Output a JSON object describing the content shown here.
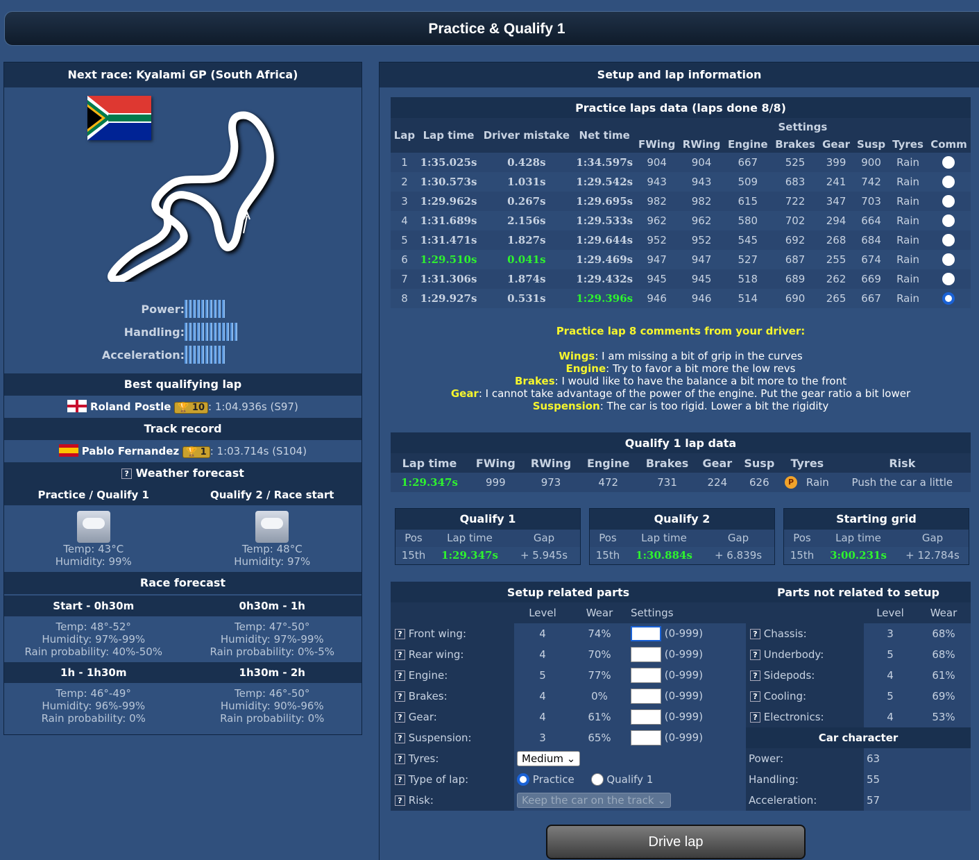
{
  "page_title": "Practice & Qualify 1",
  "left": {
    "next_race": "Next race: Kyalami GP (South Africa)",
    "stats": {
      "power_label": "Power:",
      "power_bars": 10,
      "handling_label": "Handling:",
      "handling_bars": 13,
      "accel_label": "Acceleration:",
      "accel_bars": 10
    },
    "best_q_title": "Best qualifying lap",
    "best_q": {
      "name": "Roland Postle",
      "trophy": "10",
      "time": ":  1:04.936s  (S97)"
    },
    "track_record_title": "Track record",
    "track_record": {
      "name": "Pablo Fernandez",
      "trophy": "1",
      "time": ":  1:03.714s  (S104)"
    },
    "weather_title": "Weather forecast",
    "w1": {
      "head": "Practice / Qualify 1",
      "temp": "Temp: 43°C",
      "hum": "Humidity: 99%"
    },
    "w2": {
      "head": "Qualify 2 / Race start",
      "temp": "Temp: 48°C",
      "hum": "Humidity: 97%"
    },
    "race_forecast_title": "Race forecast",
    "rf": [
      {
        "head": "Start - 0h30m",
        "temp": "Temp: 48°-52°",
        "hum": "Humidity: 97%-99%",
        "rain": "Rain probability: 40%-50%"
      },
      {
        "head": "0h30m - 1h",
        "temp": "Temp: 47°-50°",
        "hum": "Humidity: 97%-99%",
        "rain": "Rain probability: 0%-5%"
      },
      {
        "head": "1h - 1h30m",
        "temp": "Temp: 46°-49°",
        "hum": "Humidity: 96%-99%",
        "rain": "Rain probability: 0%"
      },
      {
        "head": "1h30m - 2h",
        "temp": "Temp: 46°-50°",
        "hum": "Humidity: 90%-96%",
        "rain": "Rain probability: 0%"
      }
    ]
  },
  "right": {
    "head": "Setup and lap information",
    "laps_title": "Practice laps data (laps done 8/8)",
    "cols": {
      "lap": "Lap",
      "laptime": "Lap time",
      "mistake": "Driver mistake",
      "net": "Net time",
      "settings": "Settings",
      "fwing": "FWing",
      "rwing": "RWing",
      "engine": "Engine",
      "brakes": "Brakes",
      "gear": "Gear",
      "susp": "Susp",
      "tyres": "Tyres",
      "comm": "Comm"
    },
    "laps": [
      [
        "1",
        "1:35.025s",
        "0.428s",
        "1:34.597s",
        "904",
        "904",
        "667",
        "525",
        "399",
        "900",
        "Rain"
      ],
      [
        "2",
        "1:30.573s",
        "1.031s",
        "1:29.542s",
        "943",
        "943",
        "509",
        "683",
        "241",
        "742",
        "Rain"
      ],
      [
        "3",
        "1:29.962s",
        "0.267s",
        "1:29.695s",
        "982",
        "982",
        "615",
        "722",
        "347",
        "703",
        "Rain"
      ],
      [
        "4",
        "1:31.689s",
        "2.156s",
        "1:29.533s",
        "962",
        "962",
        "580",
        "702",
        "294",
        "664",
        "Rain"
      ],
      [
        "5",
        "1:31.471s",
        "1.827s",
        "1:29.644s",
        "952",
        "952",
        "545",
        "692",
        "268",
        "684",
        "Rain"
      ],
      [
        "6",
        "1:29.510s",
        "0.041s",
        "1:29.469s",
        "947",
        "947",
        "527",
        "687",
        "255",
        "674",
        "Rain"
      ],
      [
        "7",
        "1:31.306s",
        "1.874s",
        "1:29.432s",
        "945",
        "945",
        "518",
        "689",
        "262",
        "669",
        "Rain"
      ],
      [
        "8",
        "1:29.927s",
        "0.531s",
        "1:29.396s",
        "946",
        "946",
        "514",
        "690",
        "265",
        "667",
        "Rain"
      ]
    ],
    "comments_title": "Practice lap 8 comments from your driver:",
    "comments": [
      {
        "k": "Wings",
        "v": ": I am missing a bit of grip in the curves"
      },
      {
        "k": "Engine",
        "v": ": Try to favor a bit more the low revs"
      },
      {
        "k": "Brakes",
        "v": ": I would like to have the balance a bit more to the front"
      },
      {
        "k": "Gear",
        "v": ": I cannot take advantage of the power of the engine. Put the gear ratio a bit lower"
      },
      {
        "k": "Suspension",
        "v": ": The car is too rigid. Lower a bit the rigidity"
      }
    ],
    "q1_title": "Qualify 1 lap data",
    "q1_cols": {
      "laptime": "Lap time",
      "fwing": "FWing",
      "rwing": "RWing",
      "engine": "Engine",
      "brakes": "Brakes",
      "gear": "Gear",
      "susp": "Susp",
      "tyres": "Tyres",
      "risk": "Risk"
    },
    "q1_row": {
      "laptime": "1:29.347s",
      "fwing": "999",
      "rwing": "973",
      "engine": "472",
      "brakes": "731",
      "gear": "224",
      "susp": "626",
      "tyre_icon": "P",
      "tyres": "Rain",
      "risk": "Push the car a little"
    },
    "grids": [
      {
        "title": "Qualify 1",
        "pos_h": "Pos",
        "lt_h": "Lap time",
        "gap_h": "Gap",
        "pos": "15th",
        "lt": "1:29.347s",
        "gap": "+ 5.945s"
      },
      {
        "title": "Qualify 2",
        "pos_h": "Pos",
        "lt_h": "Lap time",
        "gap_h": "Gap",
        "pos": "15th",
        "lt": "1:30.884s",
        "gap": "+ 6.839s"
      },
      {
        "title": "Starting grid",
        "pos_h": "Pos",
        "lt_h": "Lap time",
        "gap_h": "Gap",
        "pos": "15th",
        "lt": "3:00.231s",
        "gap": "+ 12.784s"
      }
    ],
    "setup_title": "Setup related parts",
    "nonsetup_title": "Parts not related to setup",
    "setup_cols": {
      "level": "Level",
      "wear": "Wear",
      "settings": "Settings"
    },
    "setup_parts": [
      {
        "label": "Front wing:",
        "level": "4",
        "wear": "74%",
        "range": "(0-999)"
      },
      {
        "label": "Rear wing:",
        "level": "4",
        "wear": "70%",
        "range": "(0-999)"
      },
      {
        "label": "Engine:",
        "level": "5",
        "wear": "77%",
        "range": "(0-999)"
      },
      {
        "label": "Brakes:",
        "level": "4",
        "wear": "0%",
        "range": "(0-999)"
      },
      {
        "label": "Gear:",
        "level": "4",
        "wear": "61%",
        "range": "(0-999)"
      },
      {
        "label": "Suspension:",
        "level": "3",
        "wear": "65%",
        "range": "(0-999)"
      }
    ],
    "other_parts": [
      {
        "label": "Chassis:",
        "level": "3",
        "wear": "68%"
      },
      {
        "label": "Underbody:",
        "level": "5",
        "wear": "68%"
      },
      {
        "label": "Sidepods:",
        "level": "4",
        "wear": "61%"
      },
      {
        "label": "Cooling:",
        "level": "5",
        "wear": "69%"
      },
      {
        "label": "Electronics:",
        "level": "4",
        "wear": "53%"
      }
    ],
    "car_character_title": "Car character",
    "car_character": [
      {
        "label": "Power:",
        "value": "63"
      },
      {
        "label": "Handling:",
        "value": "55"
      },
      {
        "label": "Acceleration:",
        "value": "57"
      }
    ],
    "tyres_label": "Tyres:",
    "tyres_value": "Medium",
    "type_label": "Type of lap:",
    "type_opt1": "Practice",
    "type_opt2": "Qualify 1",
    "risk_label": "Risk:",
    "risk_value": "Keep the car on the track",
    "drive_button": "Drive lap"
  }
}
